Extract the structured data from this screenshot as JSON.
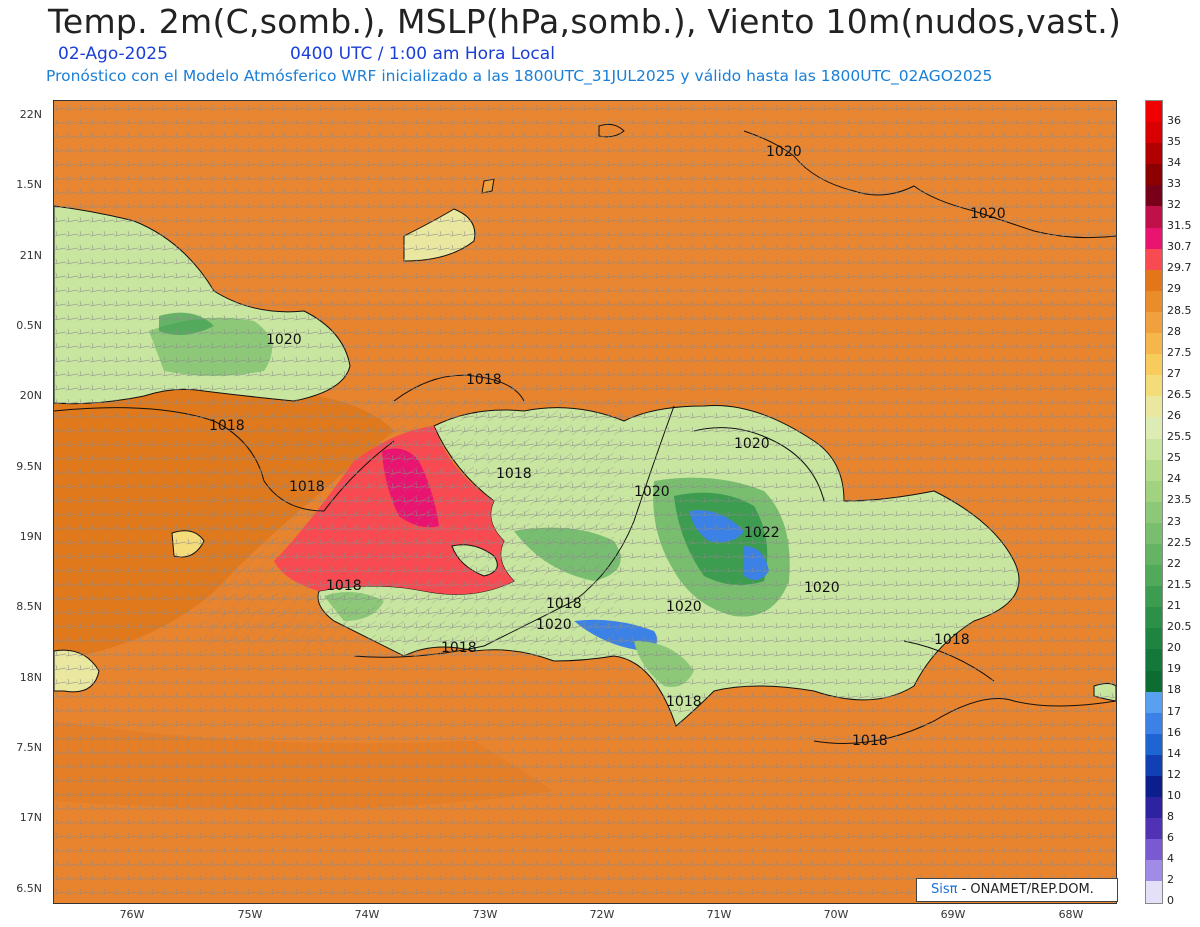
{
  "title": "Temp. 2m(C,somb.), MSLP(hPa,somb.), Viento 10m(nudos,vast.)",
  "date": "02-Ago-2025",
  "time_label": "0400 UTC / 1:00 am Hora Local",
  "model_line": "Pronóstico con el Modelo Atmósferico WRF inicializado a las 1800UTC_31JUL2025 y válido hasta las  1800UTC_02AGO2025",
  "credit": {
    "logo": "Sisπ",
    "text": "- ONAMET/REP.DOM."
  },
  "lat_labels": [
    "22N",
    "1.5N",
    "21N",
    "0.5N",
    "20N",
    "9.5N",
    "19N",
    "8.5N",
    "18N",
    "7.5N",
    "17N",
    "6.5N"
  ],
  "lon_labels": [
    "76W",
    "75W",
    "74W",
    "73W",
    "72W",
    "71W",
    "70W",
    "69W",
    "68W"
  ],
  "isobar_labels": [
    "1020",
    "1020",
    "1020",
    "1018",
    "1018",
    "1018",
    "1018",
    "1020",
    "1020",
    "1022",
    "1020",
    "1018",
    "1020",
    "1018",
    "1020",
    "1018",
    "1018",
    "1018"
  ],
  "legend": {
    "labels": [
      "36",
      "35",
      "34",
      "33",
      "32",
      "31.5",
      "30.7",
      "29.7",
      "29",
      "28.5",
      "28",
      "27.5",
      "27",
      "26.5",
      "26",
      "25.5",
      "25",
      "24",
      "23.5",
      "23",
      "22.5",
      "22",
      "21.5",
      "21",
      "20.5",
      "20",
      "19",
      "18",
      "17",
      "16",
      "14",
      "12",
      "10",
      "8",
      "6",
      "4",
      "2",
      "0"
    ],
    "colors": [
      "#f00000",
      "#d80000",
      "#b00000",
      "#8c0000",
      "#780018",
      "#c0104a",
      "#e81470",
      "#f84a50",
      "#e27618",
      "#eb8c2a",
      "#f0a03c",
      "#f5b64c",
      "#f8cc5c",
      "#f5dc7a",
      "#eae8a0",
      "#dcecb4",
      "#c8e6a0",
      "#b4dc8c",
      "#a0d280",
      "#8cc878",
      "#78be6e",
      "#64b464",
      "#50aa5a",
      "#3c9c50",
      "#2c9048",
      "#1e8440",
      "#14783a",
      "#0c6c32",
      "#5aa0f0",
      "#3c82e6",
      "#1e64d2",
      "#1040b4",
      "#0c1e8c",
      "#2e22a0",
      "#5032b4",
      "#7a5ad2",
      "#a08ce6",
      "#e4e0f8"
    ]
  },
  "colors": {
    "ocean": "#e8832e",
    "title_blue": "#1a3fd8",
    "subtitle_blue": "#1a7fd8"
  }
}
